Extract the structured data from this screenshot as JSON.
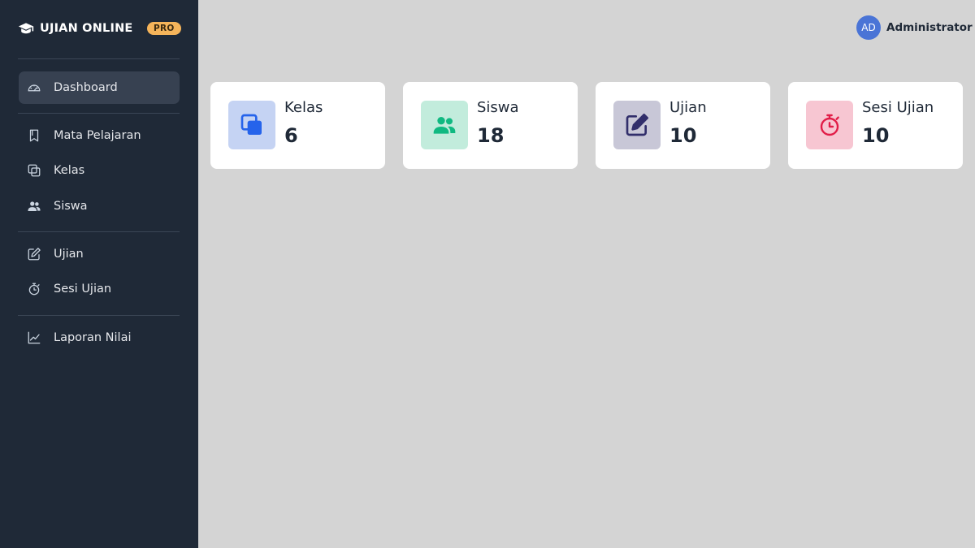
{
  "brand": {
    "name": "UJIAN ONLINE",
    "badge": "PRO",
    "icon": "graduation-cap-icon"
  },
  "sidebar": {
    "items": [
      {
        "label": "Dashboard",
        "icon": "gauge-icon",
        "active": true
      },
      {
        "label": "Mata Pelajaran",
        "icon": "bookmark-icon"
      },
      {
        "label": "Kelas",
        "icon": "copy-icon"
      },
      {
        "label": "Siswa",
        "icon": "users-icon"
      },
      {
        "label": "Ujian",
        "icon": "edit-icon"
      },
      {
        "label": "Sesi Ujian",
        "icon": "stopwatch-icon"
      },
      {
        "label": "Laporan Nilai",
        "icon": "chart-line-icon"
      }
    ]
  },
  "user": {
    "initials": "AD",
    "name": "Administrator"
  },
  "cards": [
    {
      "label": "Kelas",
      "value": "6",
      "icon": "copy-icon",
      "color": "#2563eb",
      "bg": "#c5d3f3"
    },
    {
      "label": "Siswa",
      "value": "18",
      "icon": "users-icon",
      "color": "#10b981",
      "bg": "#c2ecdc"
    },
    {
      "label": "Ujian",
      "value": "10",
      "icon": "edit-icon",
      "color": "#312e6b",
      "bg": "#c8c7d7"
    },
    {
      "label": "Sesi Ujian",
      "value": "10",
      "icon": "stopwatch-icon",
      "color": "#e11d48",
      "bg": "#f7c6d2"
    }
  ],
  "colors": {
    "sidebar_bg": "#1f2937",
    "content_bg": "#d4d4d4",
    "accent": "#4a74d6"
  }
}
